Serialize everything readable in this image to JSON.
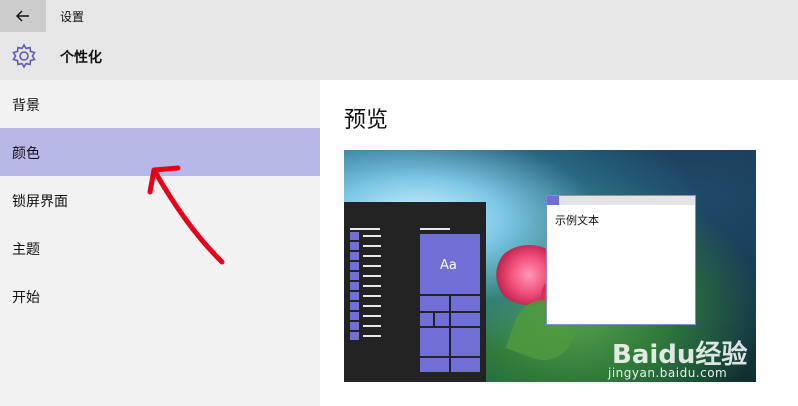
{
  "window": {
    "app_title": "设置"
  },
  "header": {
    "page_title": "个性化"
  },
  "sidebar": {
    "items": [
      {
        "label": "背景"
      },
      {
        "label": "颜色",
        "selected": true
      },
      {
        "label": "锁屏界面"
      },
      {
        "label": "主题"
      },
      {
        "label": "开始"
      }
    ]
  },
  "main": {
    "heading": "预览",
    "preview": {
      "tile_label": "Aa",
      "sample_text": "示例文本",
      "accent_color": "#6f6fd6"
    }
  },
  "watermark": {
    "brand": "Baidu经验",
    "url": "jingyan.baidu.com"
  },
  "colors": {
    "accent": "#6f6fd6",
    "selection": "#b8b8e8",
    "annotation": "#e8001a"
  },
  "icons": {
    "back": "arrow-left-icon",
    "settings": "gear-icon"
  }
}
